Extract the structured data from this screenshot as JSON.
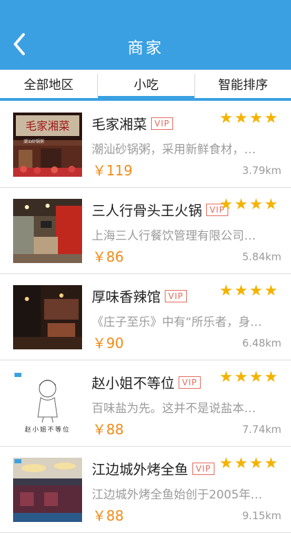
{
  "header": {
    "title": "商家",
    "back_icon": "chevron-left-icon"
  },
  "filters": [
    "全部地区",
    "小吃",
    "智能排序"
  ],
  "active_filter_index": 1,
  "colors": {
    "accent": "#3aa0e2",
    "price": "#f18b18",
    "star": "#f4b300",
    "vip": "#e46a5b"
  },
  "items": [
    {
      "name": "毛家湘菜",
      "vip": "VIP",
      "stars": "★★★★",
      "desc": "潮汕砂锅粥，采用新鲜食材，…",
      "price": "￥119",
      "distance": "3.79km",
      "sign_text": "毛家湘菜",
      "sign_sub": "潮汕砂锅粥"
    },
    {
      "name": "三人行骨头王火锅",
      "vip": "VIP",
      "stars": "★★★★",
      "desc": "上海三人行餐饮管理有限公司…",
      "price": "￥86",
      "distance": "5.84km"
    },
    {
      "name": "厚味香辣馆",
      "vip": "VIP",
      "stars": "★★★★",
      "desc": "《庄子至乐》中有“所乐者，身…",
      "price": "￥90",
      "distance": "6.48km"
    },
    {
      "name": "赵小姐不等位",
      "vip": "VIP",
      "stars": "★★★★",
      "desc": "百味盐为先。这并不是说盐本…",
      "price": "￥88",
      "distance": "7.74km",
      "logo_text": "赵小姐不等位"
    },
    {
      "name": "江边城外烤全鱼",
      "vip": "VIP",
      "stars": "★★★★",
      "desc": "江边城外烤全鱼始创于2005年…",
      "price": "￥88",
      "distance": "9.15km"
    }
  ]
}
